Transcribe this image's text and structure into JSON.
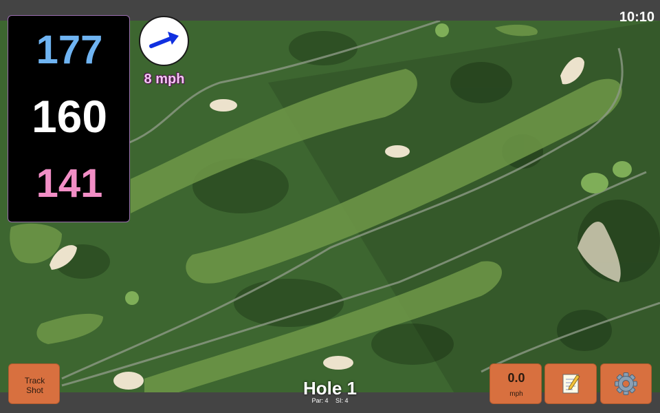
{
  "status": {
    "time": "10:10"
  },
  "distances": {
    "back": "177",
    "middle": "160",
    "front": "141",
    "back_color": "#6fb4f2",
    "middle_color": "#ffffff",
    "front_color": "#f28ec6"
  },
  "wind": {
    "speed": "8 mph",
    "direction_icon": "arrow-icon"
  },
  "hole": {
    "title": "Hole 1",
    "par": "Par: 4",
    "si": "SI: 4"
  },
  "buttons": {
    "track_shot_line1": "Track",
    "track_shot_line2": "Shot",
    "speed_value": "0.0",
    "speed_unit": "mph",
    "notes_icon": "notepad-icon",
    "settings_icon": "gear-icon"
  },
  "colors": {
    "button_bg": "#d8703f",
    "panel_bg": "#000000"
  }
}
